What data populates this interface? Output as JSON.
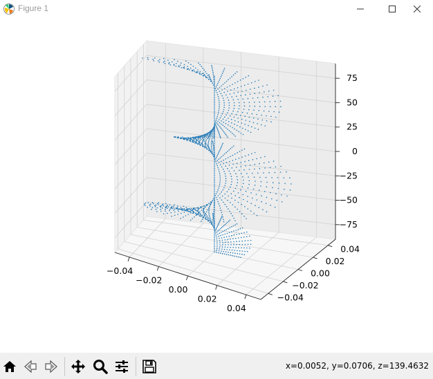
{
  "window": {
    "title": "Figure 1",
    "controls": [
      "minimize",
      "maximize",
      "close"
    ]
  },
  "toolbar": {
    "buttons": [
      {
        "name": "home",
        "icon": "home-icon"
      },
      {
        "name": "back",
        "icon": "back-arrow-icon"
      },
      {
        "name": "forward",
        "icon": "forward-arrow-icon"
      },
      {
        "name": "pan",
        "icon": "move-icon"
      },
      {
        "name": "zoom",
        "icon": "zoom-icon"
      },
      {
        "name": "configure-subplots",
        "icon": "sliders-icon"
      },
      {
        "name": "save",
        "icon": "save-icon"
      }
    ],
    "coords": "x=0.0052, y=0.0706, z=139.4632"
  },
  "chart_data": {
    "type": "scatter",
    "projection": "3d",
    "description_of_series": "points (r·cos θ, r·sin θ, z) — helical fan of dots, radius grows with z, color #1f77b4",
    "xlim": [
      -0.05,
      0.05
    ],
    "ylim": [
      -0.05,
      0.05
    ],
    "zlim": [
      -90,
      90
    ],
    "xticks": [
      "−0.04",
      "−0.02",
      "0.00",
      "0.02",
      "0.04"
    ],
    "yticks": [
      "−0.04",
      "−0.02",
      "0.00",
      "0.02",
      "0.04"
    ],
    "zticks": [
      "−75",
      "−50",
      "−25",
      "0",
      "25",
      "50",
      "75"
    ],
    "color": "#1f77b4",
    "grid": true,
    "series": [
      {
        "z_range": [
          -90,
          90
        ],
        "r_max": 0.05,
        "turns": 2.5,
        "rays": 40,
        "points_per_ray": 14
      }
    ]
  }
}
